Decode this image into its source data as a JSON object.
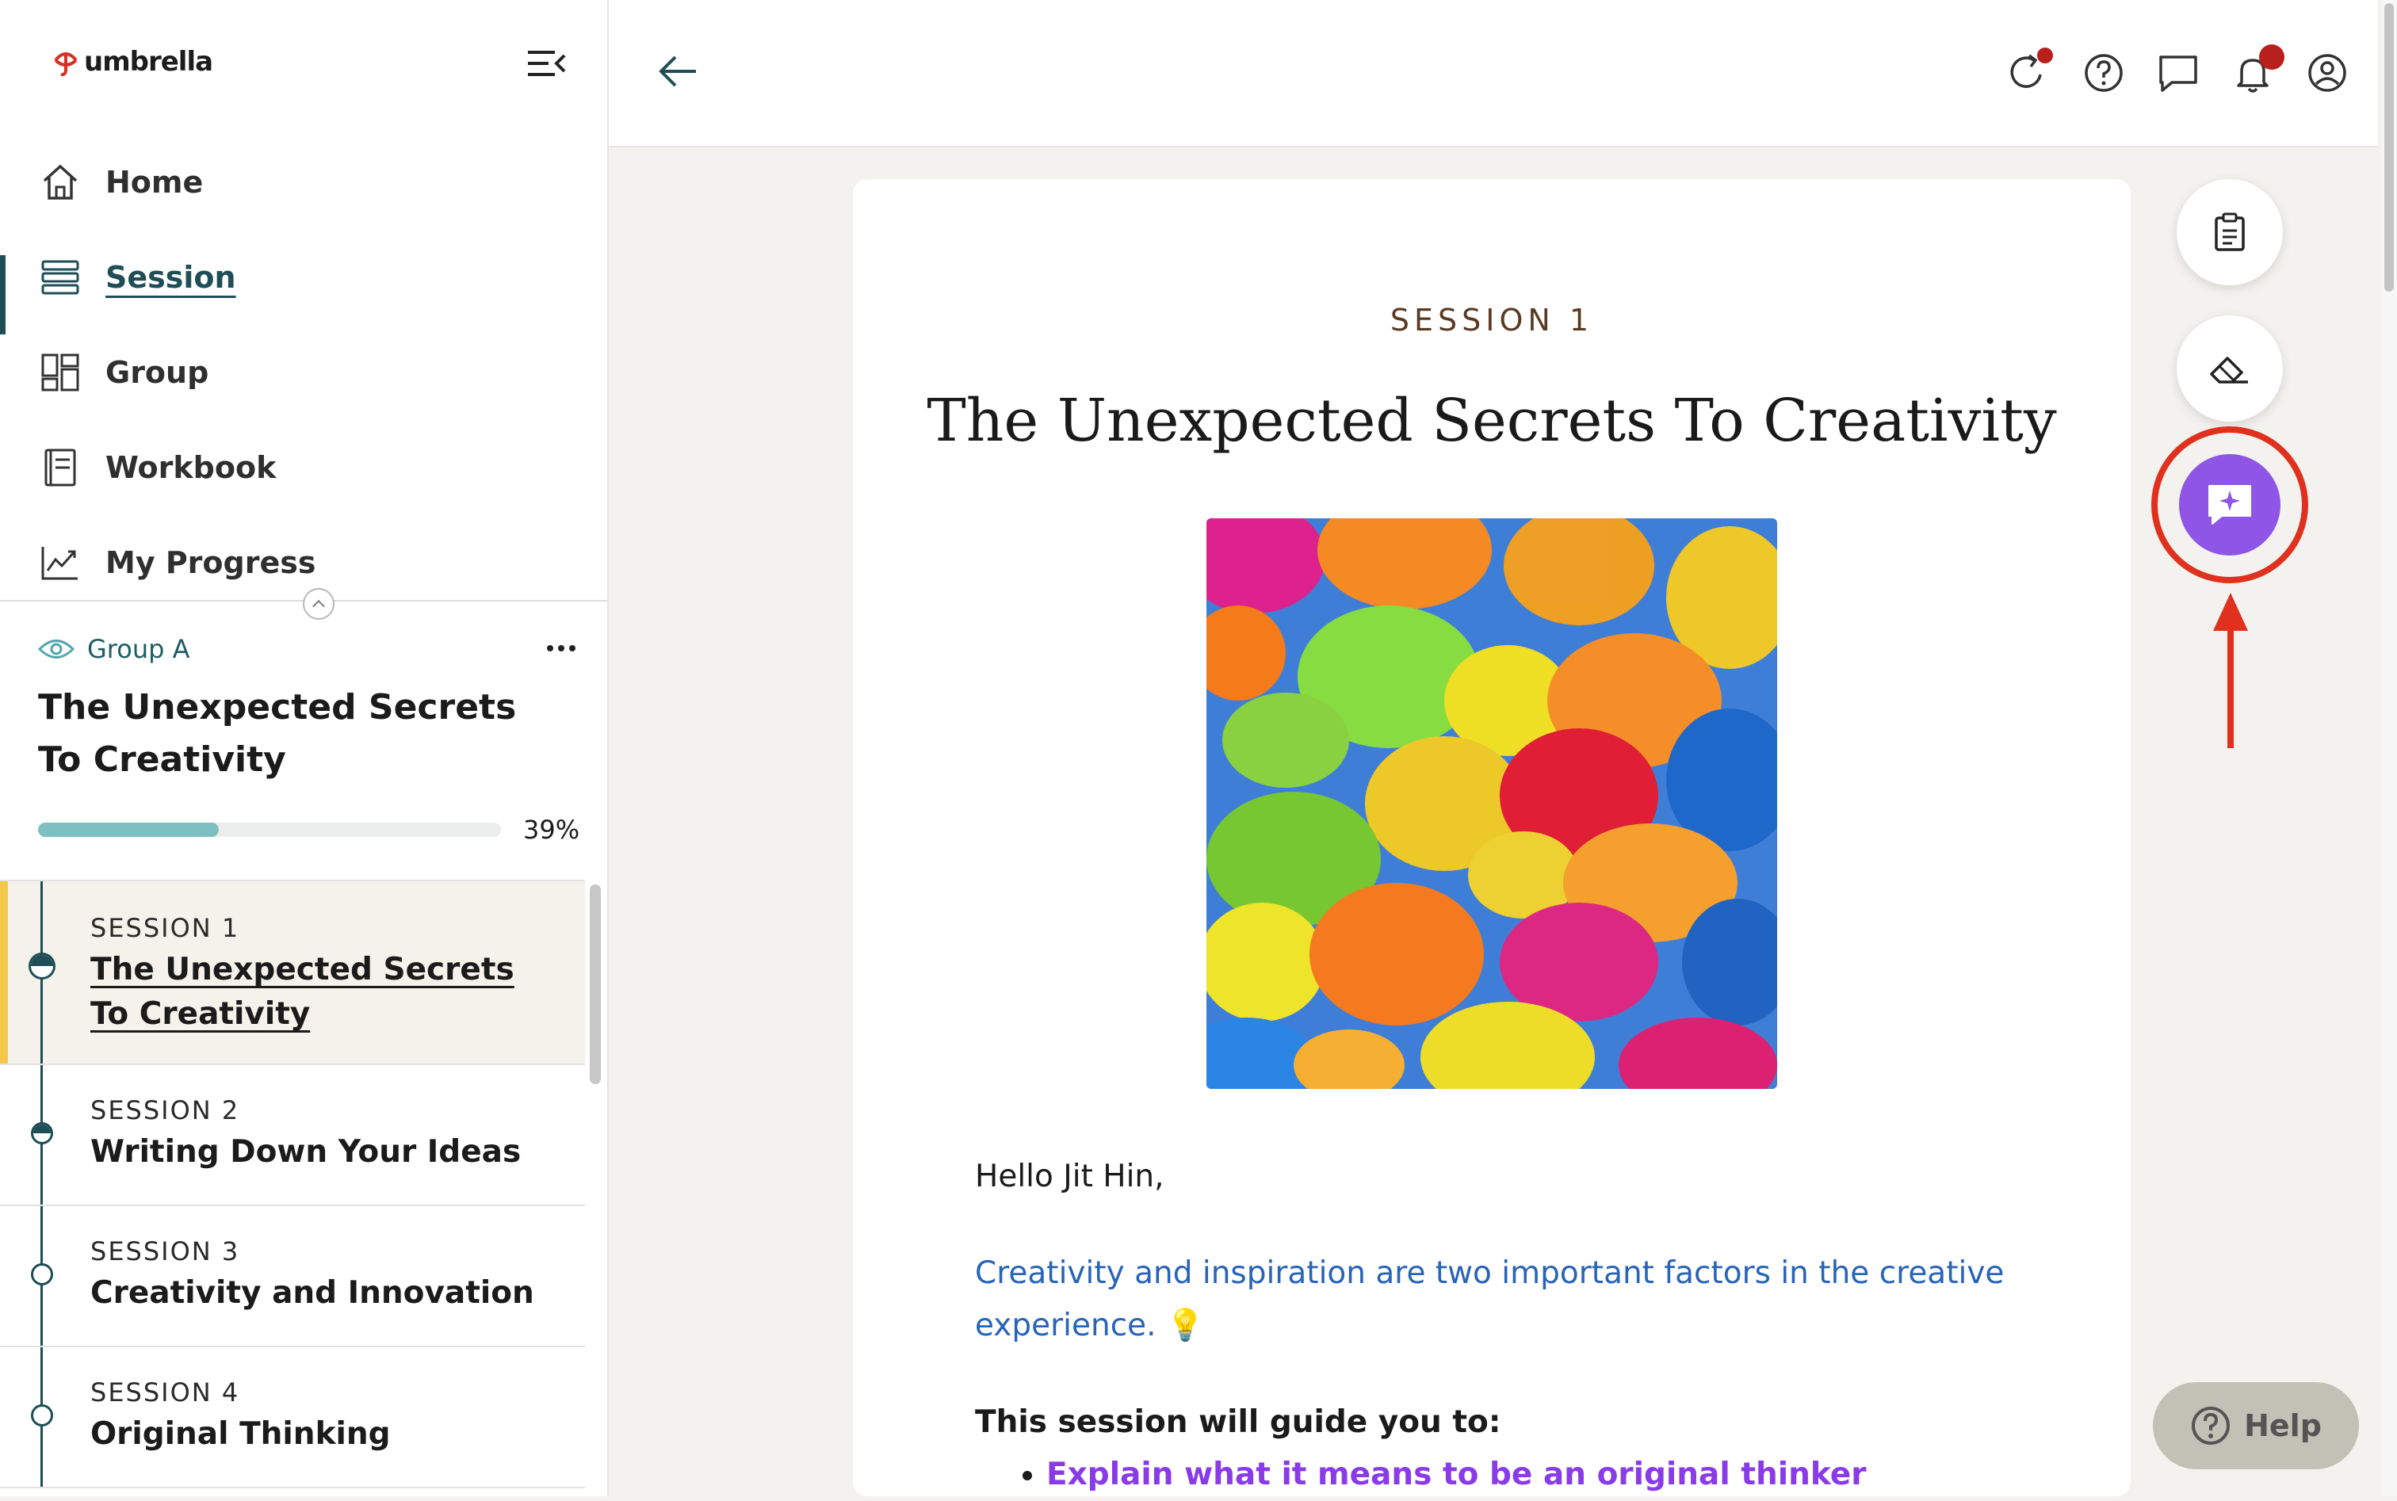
{
  "brand": {
    "name": "umbrella",
    "accent": "#d93025"
  },
  "sidebar": {
    "nav": [
      {
        "label": "Home",
        "icon": "home-icon"
      },
      {
        "label": "Session",
        "icon": "session-list-icon",
        "active": true
      },
      {
        "label": "Group",
        "icon": "group-icon"
      },
      {
        "label": "Workbook",
        "icon": "workbook-icon"
      },
      {
        "label": "My Progress",
        "icon": "chart-icon"
      }
    ],
    "group": {
      "name": "Group A",
      "title": "The Unexpected Secrets To Creativity",
      "progress": 0.39,
      "progress_label": "39%"
    },
    "sessions": [
      {
        "kicker": "SESSION 1",
        "title": "The Unexpected Secrets To Creativity",
        "status": "in-progress",
        "current": true
      },
      {
        "kicker": "SESSION 2",
        "title": "Writing Down Your Ideas",
        "status": "in-progress"
      },
      {
        "kicker": "SESSION 3",
        "title": "Creativity and Innovation",
        "status": "not-started"
      },
      {
        "kicker": "SESSION 4",
        "title": "Original Thinking",
        "status": "not-started"
      }
    ]
  },
  "topbar": {
    "icons": [
      "refresh-icon",
      "help-circle-icon",
      "chat-icon",
      "bell-icon",
      "account-icon"
    ]
  },
  "content": {
    "kicker": "SESSION 1",
    "title": "The Unexpected Secrets To Creativity",
    "greeting": "Hello Jit Hin,",
    "lede": "Creativity and inspiration are two important factors in the creative experience.",
    "lede_emoji": "💡",
    "guide_heading": "This session will guide you to:",
    "bullets": [
      "Explain what it means to be an original thinker"
    ]
  },
  "tools": [
    "clipboard-icon",
    "eraser-icon",
    "ai-chat-icon"
  ],
  "help": {
    "label": "Help"
  },
  "colors": {
    "teal": "#1f4e56",
    "progress": "#7ec0c2",
    "ai": "#8f55e6",
    "annotation": "#e0301e",
    "link": "#2864b8",
    "bullet": "#8a3be8"
  }
}
